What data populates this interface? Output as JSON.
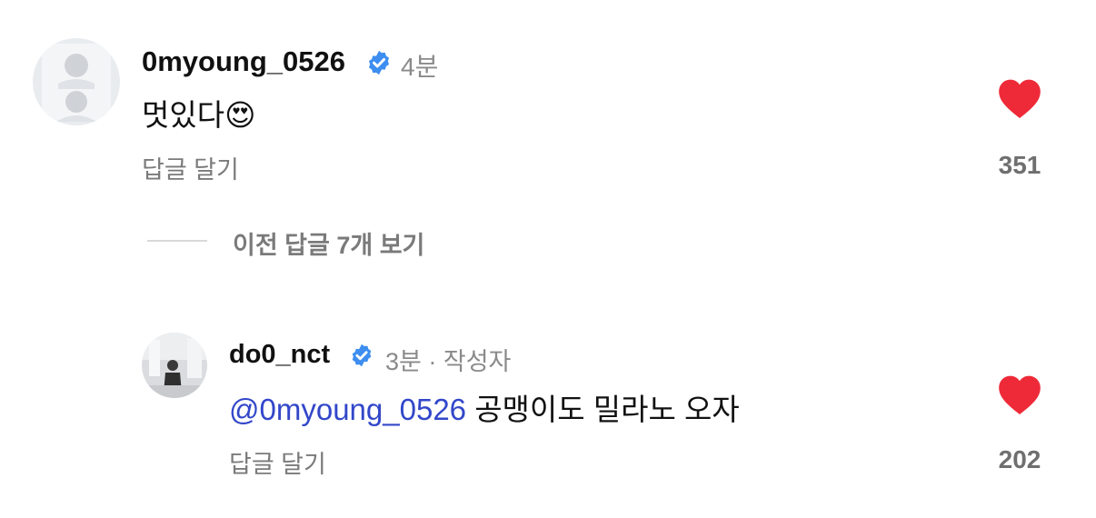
{
  "comments": [
    {
      "username": "0myoung_0526",
      "time": "4분",
      "body": "멋있다😍",
      "reply_label": "답글 달기",
      "like_count": "351"
    }
  ],
  "view_more_replies": "이전 답글 7개 보기",
  "replies": [
    {
      "username": "do0_nct",
      "time": "3분 · 작성자",
      "mention": "@0myoung_0526",
      "body": " 공맹이도 밀라노 오자",
      "reply_label": "답글 달기",
      "like_count": "202"
    }
  ],
  "colors": {
    "heart": "#ee2a38",
    "verified": "#3d8ef0",
    "mention": "#3247c9",
    "muted_text": "#7a7a7a"
  }
}
